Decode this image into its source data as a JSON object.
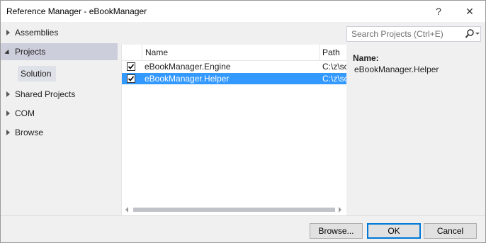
{
  "window": {
    "title": "Reference Manager - eBookManager",
    "help_label": "?",
    "close_label": "✕"
  },
  "nav": {
    "items": [
      {
        "label": "Assemblies"
      },
      {
        "label": "Projects"
      },
      {
        "label": "Shared Projects"
      },
      {
        "label": "COM"
      },
      {
        "label": "Browse"
      }
    ],
    "sub_items": [
      {
        "label": "Solution"
      }
    ]
  },
  "table": {
    "columns": [
      {
        "label": "Name"
      },
      {
        "label": "Path"
      }
    ],
    "rows": [
      {
        "checked": true,
        "name": "eBookManager.Engine",
        "path": "C:\\z\\sc",
        "selected": false
      },
      {
        "checked": true,
        "name": "eBookManager.Helper",
        "path": "C:\\z\\sc",
        "selected": true
      }
    ]
  },
  "search": {
    "placeholder": "Search Projects (Ctrl+E)",
    "icon": "search-icon"
  },
  "details": {
    "label": "Name:",
    "value": "eBookManager.Helper"
  },
  "buttons": {
    "browse": "Browse...",
    "ok": "OK",
    "cancel": "Cancel"
  },
  "colors": {
    "selection": "#3399ff",
    "nav_selected": "#cccedb",
    "default_button_border": "#0078d7"
  }
}
